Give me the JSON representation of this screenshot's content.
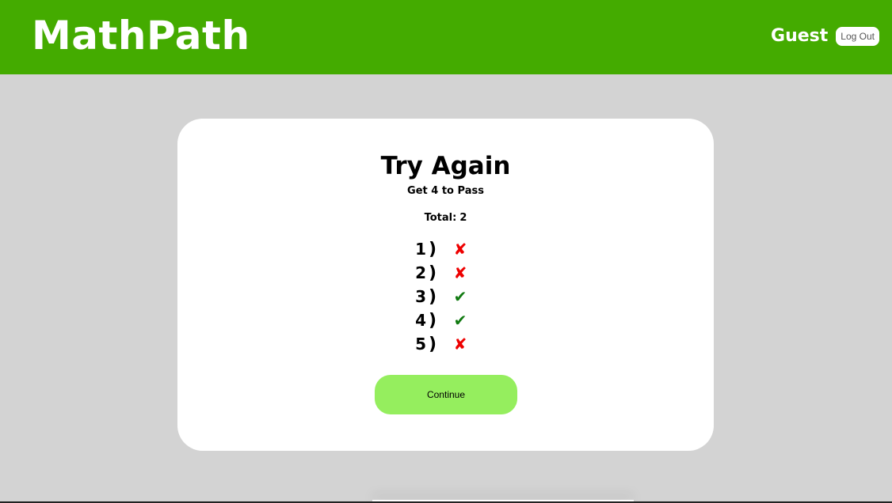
{
  "header": {
    "logo": "MathPath",
    "username": "Guest",
    "logout_label": "Log Out",
    "background_color": "#44ab00"
  },
  "result": {
    "title": "Try Again",
    "subtitle": "Get 4 to Pass",
    "total_label": "Total:",
    "total_value": "2",
    "questions": [
      {
        "number": "1",
        "paren": ")",
        "correct": false,
        "mark": "✘"
      },
      {
        "number": "2",
        "paren": ")",
        "correct": false,
        "mark": "✘"
      },
      {
        "number": "3",
        "paren": ")",
        "correct": true,
        "mark": "✔"
      },
      {
        "number": "4",
        "paren": ")",
        "correct": true,
        "mark": "✔"
      },
      {
        "number": "5",
        "paren": ")",
        "correct": false,
        "mark": "✘"
      }
    ],
    "continue_label": "Continue"
  },
  "colors": {
    "page_background": "#d3d3d3",
    "card_background": "#ffffff",
    "continue_button": "#95ee5e",
    "wrong_mark": "#ee0000",
    "correct_mark": "#117a11"
  }
}
